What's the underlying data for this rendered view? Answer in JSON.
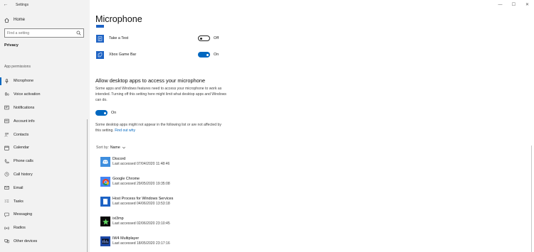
{
  "window": {
    "title": "Settings",
    "controls": {
      "minimize": "—",
      "maximize": "☐",
      "close": "✕"
    }
  },
  "sidebar": {
    "home_label": "Home",
    "search_placeholder": "Find a setting",
    "section": "Privacy",
    "group": "App permissions",
    "items": [
      {
        "label": "Microphone",
        "icon": "microphone-icon",
        "active": true
      },
      {
        "label": "Voice activation",
        "icon": "voice-activation-icon"
      },
      {
        "label": "Notifications",
        "icon": "notifications-icon"
      },
      {
        "label": "Account info",
        "icon": "account-info-icon"
      },
      {
        "label": "Contacts",
        "icon": "contacts-icon"
      },
      {
        "label": "Calendar",
        "icon": "calendar-icon"
      },
      {
        "label": "Phone calls",
        "icon": "phone-icon"
      },
      {
        "label": "Call history",
        "icon": "call-history-icon"
      },
      {
        "label": "Email",
        "icon": "email-icon"
      },
      {
        "label": "Tasks",
        "icon": "tasks-icon"
      },
      {
        "label": "Messaging",
        "icon": "messaging-icon"
      },
      {
        "label": "Radios",
        "icon": "radios-icon"
      },
      {
        "label": "Other devices",
        "icon": "other-devices-icon"
      }
    ]
  },
  "main": {
    "title": "Microphone",
    "apps": [
      {
        "name": "Take a Test",
        "state": "Off",
        "on": false,
        "icon": "take-a-test-icon"
      },
      {
        "name": "Xbox Game Bar",
        "state": "On",
        "on": true,
        "icon": "xbox-game-bar-icon"
      }
    ],
    "desktop": {
      "heading": "Allow desktop apps to access your microphone",
      "description": "Some apps and Windows features need to access your microphone to work as intended. Turning off this setting here might limit what desktop apps and Windows can do.",
      "toggle_state": "On",
      "toggle_on": true,
      "note": "Some desktop apps might not appear in the following list or are not affected by this setting.",
      "link": "Find out why"
    },
    "sort": {
      "label": "Sort by:",
      "value": "Name"
    },
    "desktop_apps": [
      {
        "name": "Discord",
        "accessed": "Last accessed 07/04/2020 11:48:46",
        "icon": "discord-icon",
        "color": "#3e8ede"
      },
      {
        "name": "Google Chrome",
        "accessed": "Last accessed 29/05/2020 19:35:08",
        "icon": "chrome-icon",
        "color": "#4285f4"
      },
      {
        "name": "Host Process for Windows Services",
        "accessed": "Last accessed 04/06/2020 13:53:18",
        "icon": "host-process-icon",
        "color": "#1e63c4"
      },
      {
        "name": "ixi3mp",
        "accessed": "Last accessed 02/06/2020 23:10:45",
        "icon": "ixi3mp-icon",
        "color": "#0a0a0a"
      },
      {
        "name": "IW4 Multiplayer",
        "accessed": "Last accessed 18/05/2020 23:17:16",
        "icon": "iw4-multiplayer-icon",
        "color": "#1e4aa8"
      }
    ]
  }
}
